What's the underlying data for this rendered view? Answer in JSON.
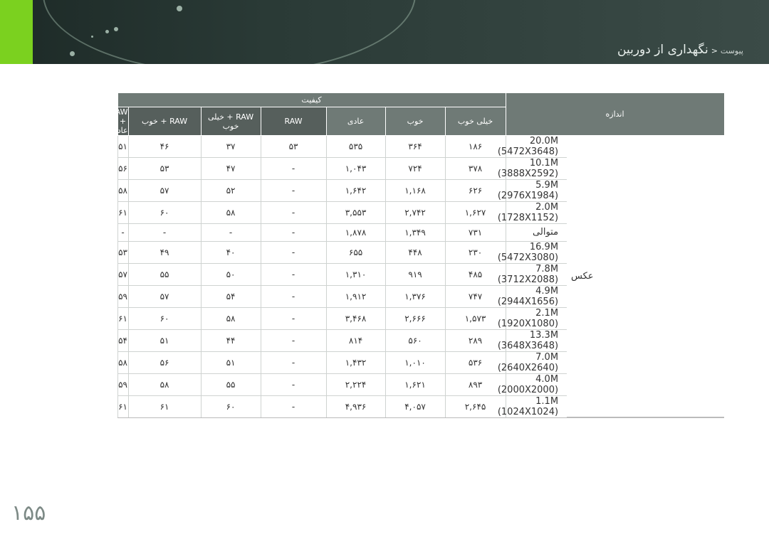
{
  "header": {
    "crumb": "پیوست",
    "separator": "<",
    "title": "نگهداری از دوربین"
  },
  "table": {
    "quality_label": "کیفیت",
    "size_label": "اندازه",
    "group_label": "عکس",
    "columns": [
      "خیلی خوب",
      "خوب",
      "عادی",
      "RAW",
      "RAW + خیلی خوب",
      "RAW + خوب",
      "RAW + عادی"
    ],
    "rows": [
      {
        "res": "20.0M (5472X3648)",
        "vals": [
          "۱۸۶",
          "۳۶۴",
          "۵۳۵",
          "۵۳",
          "۳۷",
          "۴۶",
          "۵۱"
        ]
      },
      {
        "res": "10.1M (3888X2592)",
        "vals": [
          "۳۷۸",
          "۷۲۴",
          "۱,۰۴۳",
          "-",
          "۴۷",
          "۵۳",
          "۵۶"
        ]
      },
      {
        "res": "5.9M (2976X1984)",
        "vals": [
          "۶۲۶",
          "۱,۱۶۸",
          "۱,۶۴۲",
          "-",
          "۵۲",
          "۵۷",
          "۵۸"
        ]
      },
      {
        "res": "2.0M (1728X1152)",
        "vals": [
          "۱,۶۲۷",
          "۲,۷۴۲",
          "۳,۵۵۳",
          "-",
          "۵۸",
          "۶۰",
          "۶۱"
        ]
      },
      {
        "res": "متوالی",
        "vals": [
          "۷۳۱",
          "۱,۳۴۹",
          "۱,۸۷۸",
          "-",
          "-",
          "-",
          "-"
        ]
      },
      {
        "res": "16.9M (5472X3080)",
        "vals": [
          "۲۳۰",
          "۴۴۸",
          "۶۵۵",
          "-",
          "۴۰",
          "۴۹",
          "۵۳"
        ]
      },
      {
        "res": "7.8M (3712X2088)",
        "vals": [
          "۴۸۵",
          "۹۱۹",
          "۱,۳۱۰",
          "-",
          "۵۰",
          "۵۵",
          "۵۷"
        ]
      },
      {
        "res": "4.9M (2944X1656)",
        "vals": [
          "۷۴۷",
          "۱,۳۷۶",
          "۱,۹۱۲",
          "-",
          "۵۴",
          "۵۷",
          "۵۹"
        ]
      },
      {
        "res": "2.1M (1920X1080)",
        "vals": [
          "۱,۵۷۳",
          "۲,۶۶۶",
          "۳,۴۶۸",
          "-",
          "۵۸",
          "۶۰",
          "۶۱"
        ]
      },
      {
        "res": "13.3M (3648X3648)",
        "vals": [
          "۲۸۹",
          "۵۶۰",
          "۸۱۴",
          "-",
          "۴۴",
          "۵۱",
          "۵۴"
        ]
      },
      {
        "res": "7.0M (2640X2640)",
        "vals": [
          "۵۳۶",
          "۱,۰۱۰",
          "۱,۴۳۲",
          "-",
          "۵۱",
          "۵۶",
          "۵۸"
        ]
      },
      {
        "res": "4.0M (2000X2000)",
        "vals": [
          "۸۹۳",
          "۱,۶۲۱",
          "۲,۲۲۴",
          "-",
          "۵۵",
          "۵۸",
          "۵۹"
        ]
      },
      {
        "res": "1.1M (1024X1024)",
        "vals": [
          "۲,۶۴۵",
          "۴,۰۵۷",
          "۴,۹۳۶",
          "-",
          "۶۰",
          "۶۱",
          "۶۱"
        ]
      }
    ]
  },
  "page_number": "۱۵۵",
  "colors": {
    "accent": "#7bd11f",
    "banner": "#2a3a36",
    "header_cell": "#6f7a76"
  }
}
